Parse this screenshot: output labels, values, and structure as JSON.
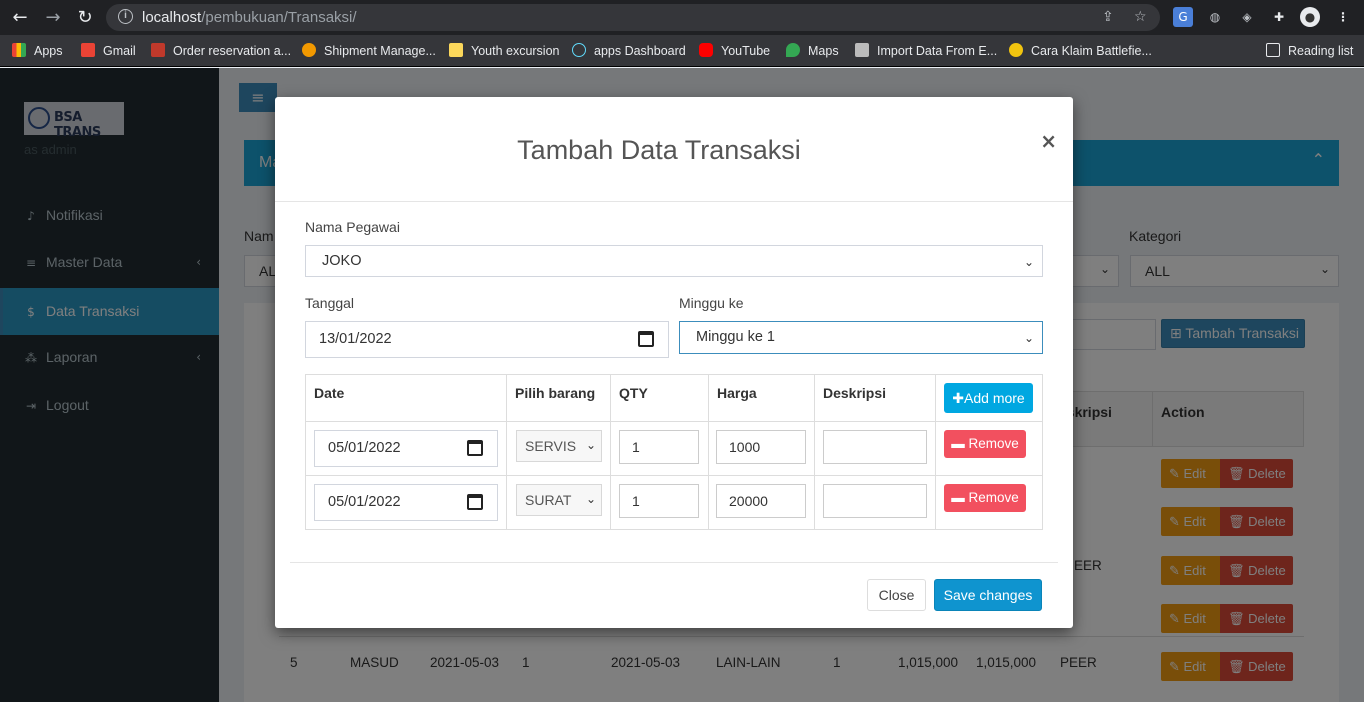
{
  "browser": {
    "url_host": "localhost",
    "url_path": "/pembukuan/Transaksi/",
    "bookmarks": [
      {
        "label": "Apps",
        "color": "#e8453c"
      },
      {
        "label": "Gmail",
        "color": "#ea4335"
      },
      {
        "label": "Order reservation a...",
        "color": "#c0392b"
      },
      {
        "label": "Shipment Manage...",
        "color": "#f29900"
      },
      {
        "label": "Youth excursion",
        "color": "#fbd75b"
      },
      {
        "label": "apps Dashboard",
        "color": "#61dafb"
      },
      {
        "label": "YouTube",
        "color": "#ff0000"
      },
      {
        "label": "Maps",
        "color": "#34a853"
      },
      {
        "label": "Import Data From E...",
        "color": "#bbbbbb"
      },
      {
        "label": "Cara Klaim Battlefie...",
        "color": "#f1c40f"
      }
    ],
    "reading_list": "Reading list"
  },
  "sidebar": {
    "logo_text": "BSA TRANS",
    "role": "as admin",
    "items": [
      {
        "label": "Notifikasi",
        "icon": "bell-icon",
        "glyph": "🔔"
      },
      {
        "label": "Master Data",
        "icon": "database-icon",
        "glyph": "≡"
      },
      {
        "label": "Data Transaksi",
        "icon": "dollar-icon",
        "glyph": "$"
      },
      {
        "label": "Laporan",
        "icon": "sitemap-icon",
        "glyph": "⁂"
      },
      {
        "label": "Logout",
        "icon": "logout-icon",
        "glyph": "⇥"
      }
    ]
  },
  "background": {
    "box_title": "Ma",
    "filter_name_label": "Nam",
    "filter_name_value": "AL",
    "filter_kategori_label": "Kategori",
    "filter_kategori_value": "ALL",
    "tambah_button": "Tambah Transaksi",
    "col_deskripsi": "eskripsi",
    "col_action": "Action",
    "edit_label": "Edit",
    "delete_label": "Delete",
    "row_peer_a": "EER",
    "last_row": [
      "5",
      "MASUD",
      "2021-05-03",
      "1",
      "2021-05-03",
      "LAIN-LAIN",
      "1",
      "1,015,000",
      "1,015,000",
      "PEER"
    ]
  },
  "modal": {
    "title": "Tambah Data Transaksi",
    "nama_pegawai_label": "Nama Pegawai",
    "nama_pegawai_value": "JOKO",
    "tanggal_label": "Tanggal",
    "tanggal_value": "13/01/2022",
    "minggu_label": "Minggu ke",
    "minggu_value": "Minggu ke 1",
    "table_headers": [
      "Date",
      "Pilih barang",
      "QTY",
      "Harga",
      "Deskripsi"
    ],
    "add_more_label": "Add more",
    "rows": [
      {
        "date": "05/01/2022",
        "barang": "SERVIS",
        "qty": "1",
        "harga": "1000",
        "deskripsi": "",
        "remove": "Remove"
      },
      {
        "date": "05/01/2022",
        "barang": "SURAT",
        "qty": "1",
        "harga": "20000",
        "deskripsi": "",
        "remove": "Remove"
      }
    ],
    "close_label": "Close",
    "save_label": "Save changes"
  }
}
